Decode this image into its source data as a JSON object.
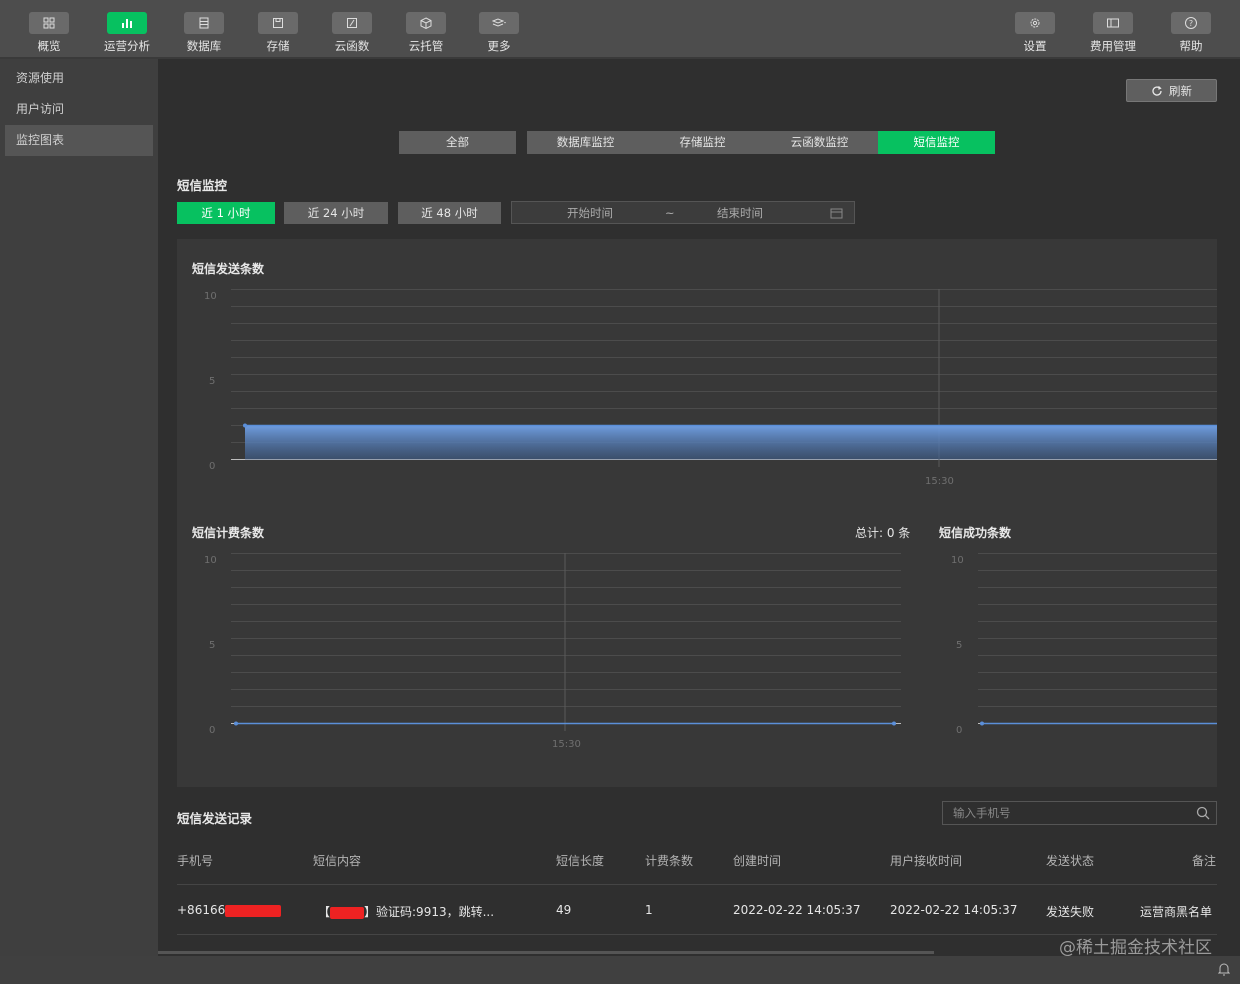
{
  "toolbar": {
    "items": [
      {
        "label": "概览",
        "icon": "grid-icon"
      },
      {
        "label": "运营分析",
        "icon": "bar-chart-icon"
      },
      {
        "label": "数据库",
        "icon": "database-icon"
      },
      {
        "label": "存储",
        "icon": "save-icon"
      },
      {
        "label": "云函数",
        "icon": "function-icon"
      },
      {
        "label": "云托管",
        "icon": "cube-icon"
      },
      {
        "label": "更多",
        "icon": "layers-icon"
      }
    ],
    "right_items": [
      {
        "label": "设置",
        "icon": "gear-icon"
      },
      {
        "label": "费用管理",
        "icon": "billing-icon"
      },
      {
        "label": "帮助",
        "icon": "help-icon"
      }
    ]
  },
  "sidebar": {
    "items": [
      {
        "label": "资源使用"
      },
      {
        "label": "用户访问"
      },
      {
        "label": "监控图表"
      }
    ]
  },
  "main": {
    "refresh_label": "刷新",
    "tabs": [
      {
        "label": "全部"
      },
      {
        "label": "数据库监控"
      },
      {
        "label": "存储监控"
      },
      {
        "label": "云函数监控"
      },
      {
        "label": "短信监控"
      }
    ],
    "section_title": "短信监控",
    "ranges": [
      {
        "label": "近 1 小时"
      },
      {
        "label": "近 24 小时"
      },
      {
        "label": "近 48 小时"
      }
    ],
    "date_range": {
      "start_placeholder": "开始时间",
      "separator": "~",
      "end_placeholder": "结束时间"
    },
    "total_label": "总计: 0 条"
  },
  "chart_data": [
    {
      "type": "area",
      "title": "短信发送条数",
      "ylim": [
        0,
        10
      ],
      "yticks": [
        "10",
        "5",
        "0"
      ],
      "xticks": [
        "15:30"
      ],
      "series": [
        {
          "values": [
            2,
            2
          ]
        }
      ]
    },
    {
      "type": "line",
      "title": "短信计费条数",
      "ylim": [
        0,
        10
      ],
      "yticks": [
        "10",
        "5",
        "0"
      ],
      "xticks": [
        "15:30"
      ],
      "series": [
        {
          "values": [
            0,
            0
          ]
        }
      ]
    },
    {
      "type": "line",
      "title": "短信成功条数",
      "ylim": [
        0,
        10
      ],
      "yticks": [
        "10",
        "5",
        "0"
      ],
      "xticks": [],
      "series": [
        {
          "values": [
            0,
            0
          ]
        }
      ]
    }
  ],
  "records": {
    "title": "短信发送记录",
    "search_placeholder": "输入手机号",
    "columns": [
      "手机号",
      "短信内容",
      "短信长度",
      "计费条数",
      "创建时间",
      "用户接收时间",
      "发送状态",
      "备注"
    ],
    "rows": [
      {
        "phone": "+86166",
        "content_open": "【",
        "content_close": "】验证码:9913，跳转...",
        "length": "49",
        "billed": "1",
        "created": "2022-02-22 14:05:37",
        "received": "2022-02-22 14:05:37",
        "status": "发送失败",
        "note": "运营商黑名单"
      }
    ]
  },
  "watermark": "@稀土掘金技术社区",
  "colors": {
    "accent": "#07c160",
    "series": "#5b8fd9"
  }
}
